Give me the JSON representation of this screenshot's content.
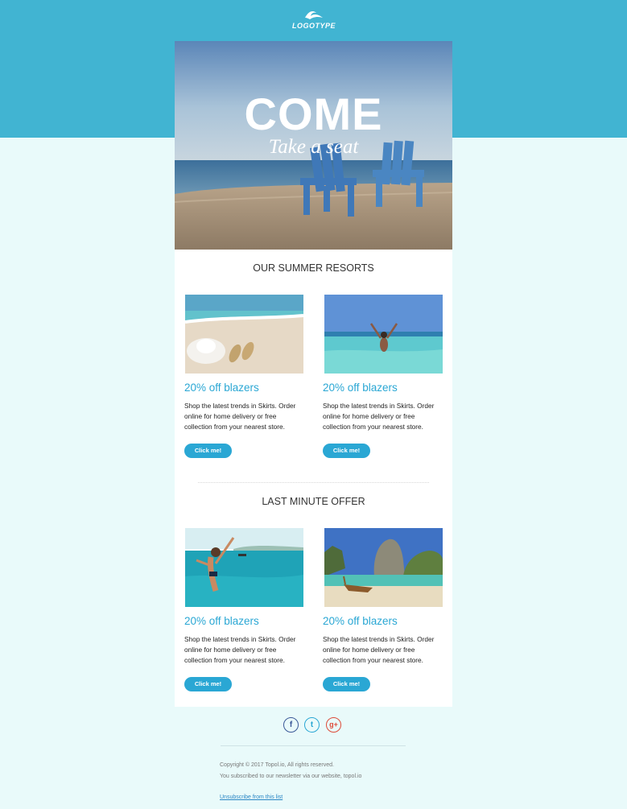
{
  "brand": {
    "logo_text": "LOGOTYPE"
  },
  "hero": {
    "title": "COME",
    "subtitle": "Take a seat"
  },
  "sections": [
    {
      "title": "OUR SUMMER RESORTS",
      "products": [
        {
          "image": "beach-hat-sandals",
          "title": "20% off blazers",
          "description": "Shop the latest trends in Skirts. Order online for home delivery or free collection from your nearest store.",
          "button": "Click me!"
        },
        {
          "image": "woman-in-sea",
          "title": "20% off blazers",
          "description": "Shop the latest trends in Skirts. Order online for home delivery or free collection from your nearest store.",
          "button": "Click me!"
        }
      ]
    },
    {
      "title": "LAST MINUTE OFFER",
      "products": [
        {
          "image": "woman-jumping-water",
          "title": "20% off blazers",
          "description": "Shop the latest trends in Skirts. Order online for home delivery or free collection from your nearest store.",
          "button": "Click me!"
        },
        {
          "image": "longtail-boat-island",
          "title": "20% off blazers",
          "description": "Shop the latest trends in Skirts. Order online for home delivery or free collection from your nearest store.",
          "button": "Click me!"
        }
      ]
    }
  ],
  "social": [
    {
      "icon": "facebook-icon",
      "glyph": "f"
    },
    {
      "icon": "twitter-icon",
      "glyph": "t"
    },
    {
      "icon": "google-plus-icon",
      "glyph": "g+"
    }
  ],
  "footer": {
    "copyright": "Copyright © 2017 Topol.io, All rights reserved.",
    "subscribed": "You subscribed to our newsletter via our website, topol.io",
    "unsubscribe": "Unsubscribe from this list"
  },
  "colors": {
    "header": "#41b4d2",
    "background": "#e9fafa",
    "accent": "#2aa7d4"
  }
}
